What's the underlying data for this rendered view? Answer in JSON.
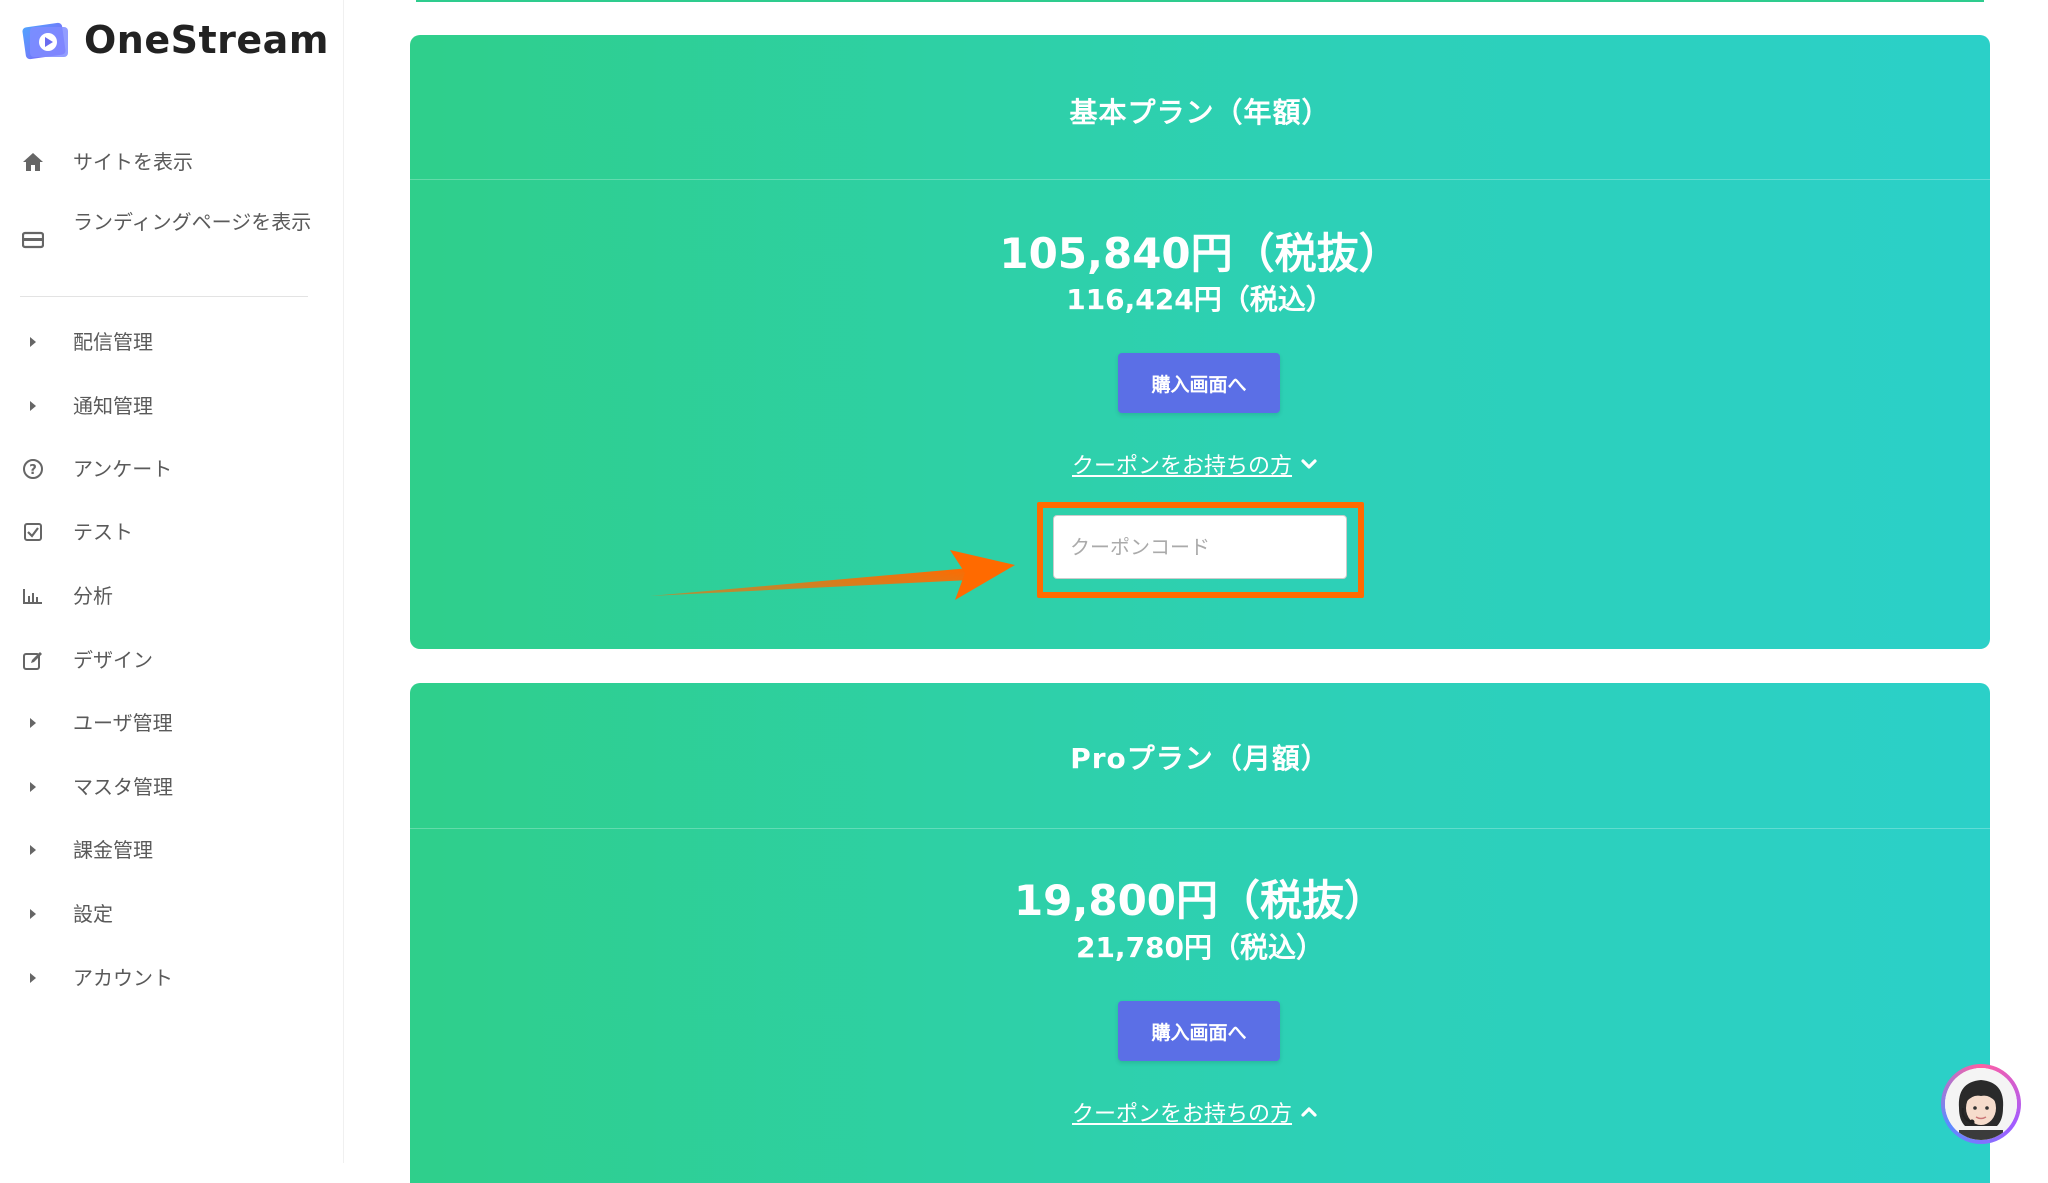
{
  "app": {
    "name": "OneStream"
  },
  "sidebar": {
    "top_items": [
      {
        "label": "サイトを表示",
        "icon": "home-icon"
      },
      {
        "label": "ランディングページを表示",
        "icon": "card-icon"
      }
    ],
    "items": [
      {
        "label": "配信管理",
        "icon": "caret-right-icon"
      },
      {
        "label": "通知管理",
        "icon": "caret-right-icon"
      },
      {
        "label": "アンケート",
        "icon": "question-circle-icon"
      },
      {
        "label": "テスト",
        "icon": "checkbox-icon"
      },
      {
        "label": "分析",
        "icon": "bar-chart-icon"
      },
      {
        "label": "デザイン",
        "icon": "edit-icon"
      },
      {
        "label": "ユーザ管理",
        "icon": "caret-right-icon"
      },
      {
        "label": "マスタ管理",
        "icon": "caret-right-icon"
      },
      {
        "label": "課金管理",
        "icon": "caret-right-icon"
      },
      {
        "label": "設定",
        "icon": "caret-right-icon"
      },
      {
        "label": "アカウント",
        "icon": "caret-right-icon"
      }
    ]
  },
  "plans": [
    {
      "title": "基本プラン（年額）",
      "price_ex_tax": "105,840円（税抜）",
      "price_in_tax": "116,424円（税込）",
      "buy_label": "購入画面へ",
      "coupon_link": "クーポンをお持ちの方",
      "coupon_expanded": true,
      "coupon_placeholder": "クーポンコード"
    },
    {
      "title": "Proプラン（月額）",
      "price_ex_tax": "19,800円（税抜）",
      "price_in_tax": "21,780円（税込）",
      "buy_label": "購入画面へ",
      "coupon_link": "クーポンをお持ちの方",
      "coupon_expanded": false
    }
  ],
  "colors": {
    "card_gradient_start": "#2fcf8b",
    "card_gradient_end": "#2bd0c8",
    "buy_button": "#5b6fe6",
    "highlight": "#ff6a00"
  }
}
